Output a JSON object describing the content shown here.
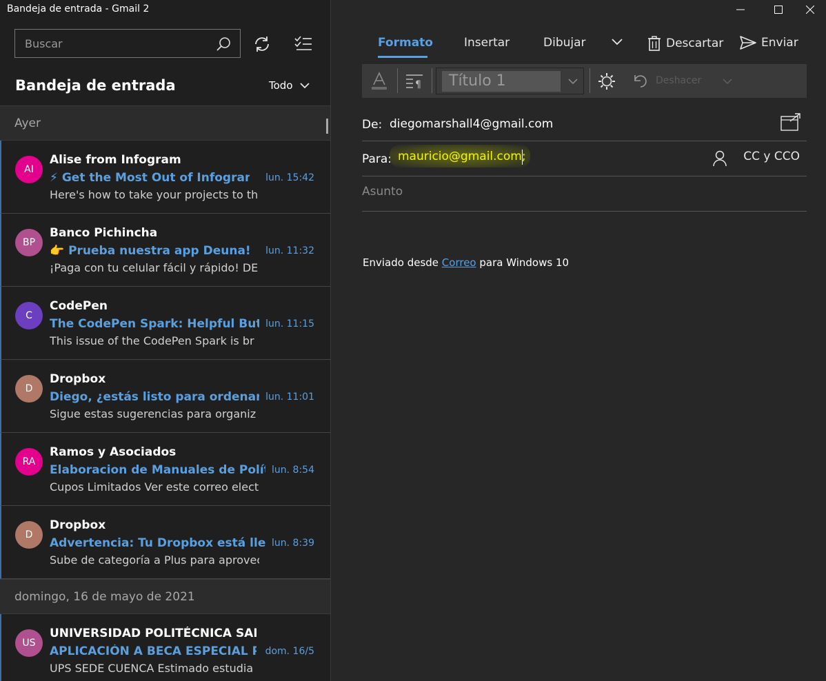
{
  "window": {
    "title": "Bandeja de entrada - Gmail 2"
  },
  "search": {
    "placeholder": "Buscar"
  },
  "inbox": {
    "heading": "Bandeja de entrada",
    "filter": "Todo"
  },
  "groups": [
    {
      "label": "Ayer",
      "messages": [
        {
          "initials": "AI",
          "avatar_color": "#e3008c",
          "sender": "Alise from Infogram",
          "subject": "⚡ Get the Most Out of Infogram",
          "time": "lun. 15:42",
          "preview": "Here's how to take your projects to th"
        },
        {
          "initials": "BP",
          "avatar_color": "#b0508f",
          "sender": "Banco Pichincha",
          "subject": "👉 Prueba nuestra app Deuna!",
          "time": "lun. 11:32",
          "preview": "¡Paga con tu celular fácil y rápido! DE"
        },
        {
          "initials": "C",
          "avatar_color": "#6b3fc0",
          "sender": "CodePen",
          "subject": "The CodePen Spark: Helpful Buttons",
          "time": "lun. 11:15",
          "preview": "This issue of the CodePen Spark is br"
        },
        {
          "initials": "D",
          "avatar_color": "#b07866",
          "sender": "Dropbox",
          "subject": "Diego, ¿estás listo para ordenar tu v",
          "time": "lun. 11:01",
          "preview": "Sigue estas sugerencias para organiz"
        },
        {
          "initials": "RA",
          "avatar_color": "#e3008c",
          "sender": "Ramos y Asociados",
          "subject": "Elaboracion de Manuales de Políticas",
          "time": "lun. 8:54",
          "preview": "Cupos Limitados Ver este correo elect"
        },
        {
          "initials": "D",
          "avatar_color": "#b07866",
          "sender": "Dropbox",
          "subject": "Advertencia: Tu Dropbox está lleno",
          "time": "lun. 8:39",
          "preview": "Sube de categoría a Plus para aprovec"
        }
      ]
    },
    {
      "label": "domingo, 16 de mayo de 2021",
      "messages": [
        {
          "initials": "US",
          "avatar_color": "#b0508f",
          "sender": "UNIVERSIDAD POLITÉCNICA SALES",
          "subject": "APLICACIÓN A BECA ESPECIAL PER",
          "time": "dom. 16/5",
          "preview": "UPS SEDE CUENCA Estimado estudia"
        }
      ]
    }
  ],
  "compose": {
    "tabs": [
      "Formato",
      "Insertar",
      "Dibujar"
    ],
    "discard_label": "Descartar",
    "send_label": "Enviar",
    "style_value": "Título 1",
    "undo_label": "Deshacer",
    "from_label": "De:",
    "from_value": "diegomarshall4@gmail.com",
    "to_label": "Para:",
    "to_value": "mauricio@gmail.com;",
    "cc_label": "CC y CCO",
    "subject_placeholder": "Asunto",
    "signature": {
      "prefix": "Enviado desde",
      "link": "Correo",
      "suffix": "para Windows 10"
    }
  },
  "colors": {
    "accent": "#5aa0e0",
    "highlight": "#f5f500"
  }
}
